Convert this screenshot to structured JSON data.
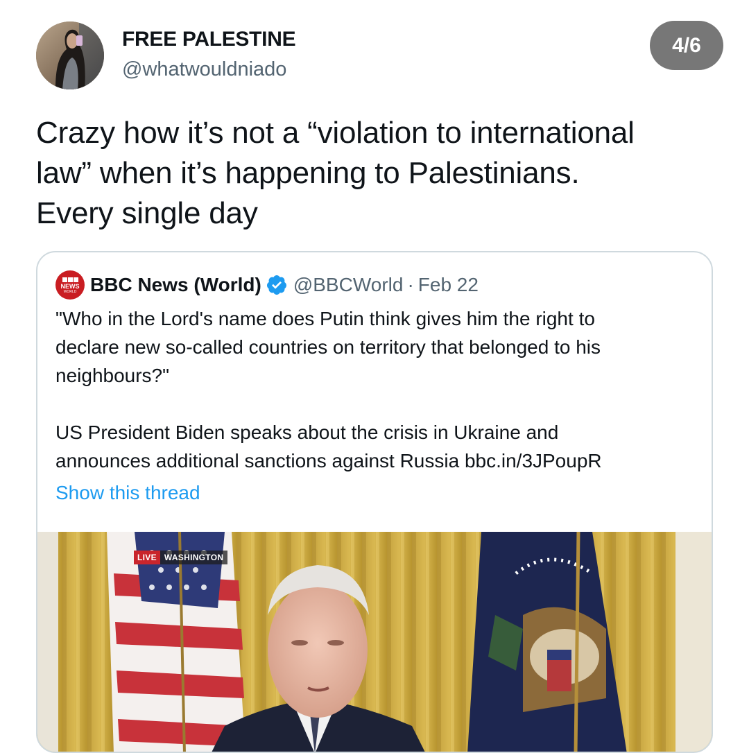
{
  "author": {
    "display_name": "FREE PALESTINE",
    "handle": "@whatwouldniado"
  },
  "page_indicator": "4/6",
  "tweet": {
    "lines": [
      "Crazy how it’s not a “violation to international",
      "law” when it’s happening to Palestinians.",
      "Every single day"
    ]
  },
  "quoted_tweet": {
    "display_name": "BBC News (World)",
    "handle": "@BBCWorld",
    "separator": "·",
    "date": "Feb 22",
    "logo_text": "NEWS",
    "logo_subtext": "WORLD",
    "paragraph1_lines": [
      "\"Who in the Lord's name does Putin think gives him the right to",
      "declare new so-called countries on territory that belonged to his",
      "neighbours?\""
    ],
    "paragraph2_lines": [
      "US President Biden speaks about the crisis in Ukraine and",
      "announces additional sanctions against Russia bbc.in/3JPoupR"
    ],
    "show_thread_label": "Show this thread",
    "media": {
      "live_label": "LIVE",
      "location_label": "WASHINGTON"
    }
  },
  "colors": {
    "link": "#1d9bf0",
    "verified": "#1d9bf0",
    "badge_background": "#777777",
    "bbc_red": "#c91d22"
  },
  "icons": {
    "verified": "verified-badge-icon",
    "bbc": "bbc-news-logo"
  }
}
